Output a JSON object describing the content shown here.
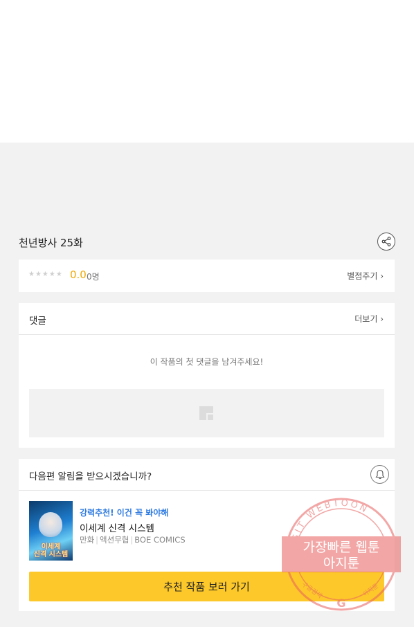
{
  "episode": {
    "title": "천년방사 25화"
  },
  "rating": {
    "stars": "★★★★★",
    "score": "0.0",
    "count": "0명",
    "action": "별점주기 ›"
  },
  "comments": {
    "heading": "댓글",
    "more": "더보기 ›",
    "empty": "이 작품의 첫 댓글을 남겨주세요!"
  },
  "notify": {
    "question": "다음편 알림을 받으시겠습니까?"
  },
  "recommendation": {
    "tag": "강력추천! 이건 꼭 봐야해",
    "title": "이세계 신격 시스템",
    "thumb_text": "이세계\n신격 시스템",
    "genre": "만화",
    "subgenre": "액션무협",
    "publisher": "BOE COMICS",
    "cta": "추천 작품 보러 가기"
  },
  "watermark": {
    "arc_text": "AGIT WEBTOON",
    "line1": "가장빠른 웹툰",
    "line2": "아지툰",
    "bottom_left": "구글검색",
    "bottom_right": "아지툰",
    "center_letter": "G"
  },
  "colors": {
    "accent_yellow": "#fdc82a",
    "score_orange": "#f0a800",
    "tag_blue": "#2f7be0",
    "stamp_red": "#e8615f"
  }
}
